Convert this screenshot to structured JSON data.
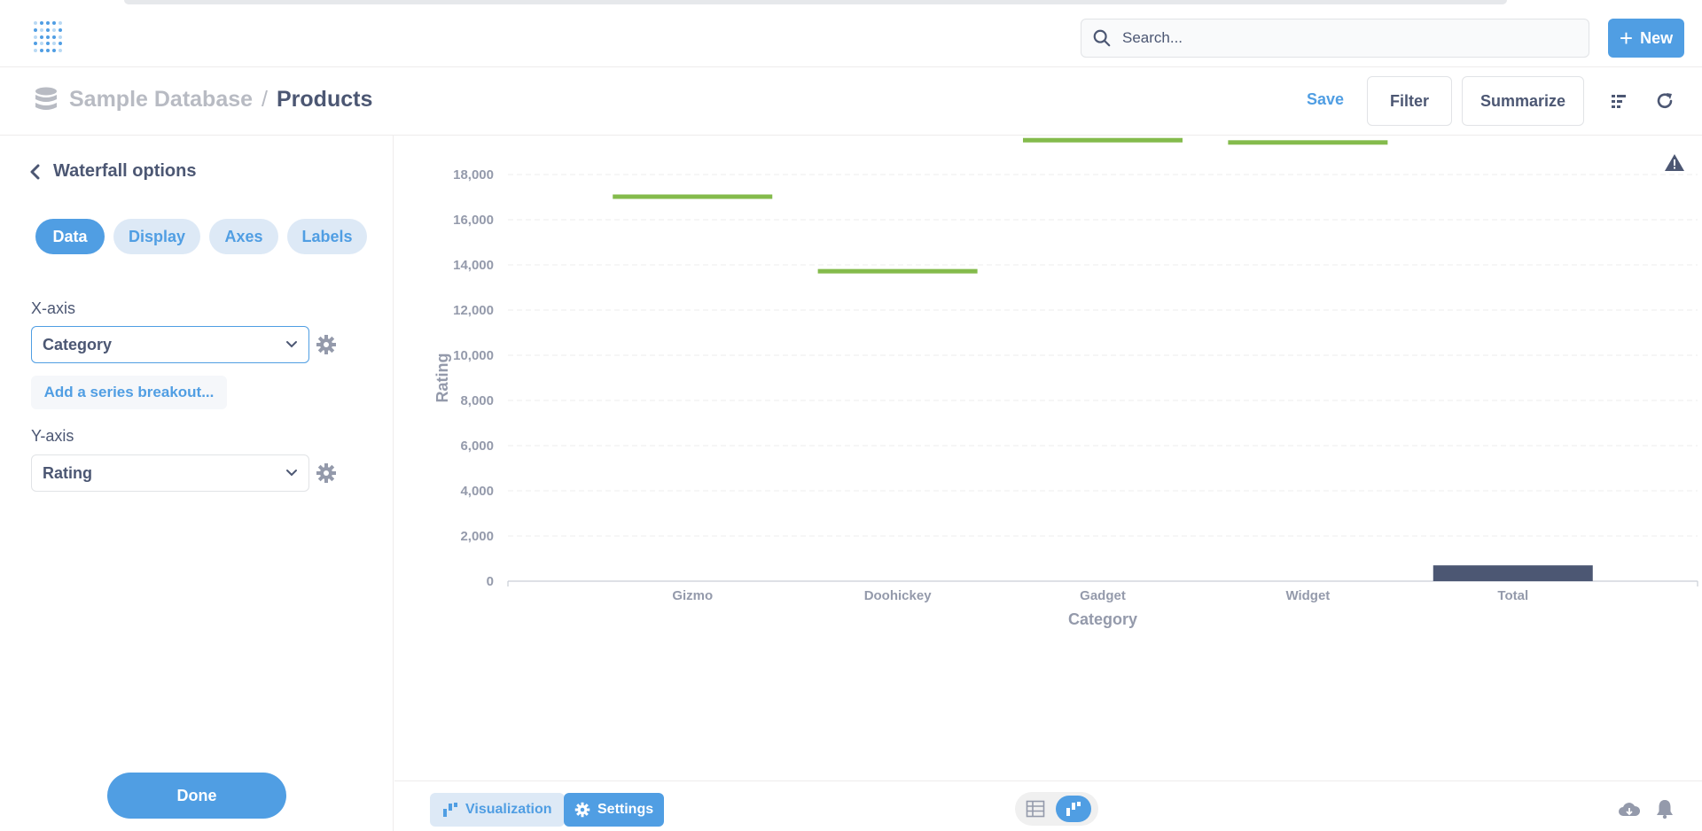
{
  "topnav": {
    "search_placeholder": "Search...",
    "new_label": "New"
  },
  "header": {
    "database": "Sample Database",
    "separator": "/",
    "table": "Products",
    "save_label": "Save",
    "filter_label": "Filter",
    "summarize_label": "Summarize"
  },
  "sidebar": {
    "title": "Waterfall options",
    "tabs": [
      {
        "label": "Data",
        "active": true
      },
      {
        "label": "Display",
        "active": false
      },
      {
        "label": "Axes",
        "active": false
      },
      {
        "label": "Labels",
        "active": false
      }
    ],
    "x_axis_label": "X-axis",
    "x_axis_value": "Category",
    "breakout_label": "Add a series breakout...",
    "y_axis_label": "Y-axis",
    "y_axis_value": "Rating",
    "done_label": "Done"
  },
  "footer": {
    "visualization_label": "Visualization",
    "settings_label": "Settings"
  },
  "colors": {
    "accent": "#509ee3",
    "increase": "#84bb4c",
    "total": "#4c5773",
    "axis_text": "#949aab"
  },
  "chart_data": {
    "type": "waterfall",
    "categories": [
      "Gizmo",
      "Doohickey",
      "Gadget",
      "Widget",
      "Total"
    ],
    "values": [
      17000,
      13700,
      19500,
      19400,
      700
    ],
    "bar_kind": [
      "increase",
      "increase",
      "increase",
      "increase",
      "total"
    ],
    "xlabel": "Category",
    "ylabel": "Rating",
    "yticks": [
      0,
      2000,
      4000,
      6000,
      8000,
      10000,
      12000,
      14000,
      16000,
      18000
    ],
    "ytick_labels": [
      "0",
      "2,000",
      "4,000",
      "6,000",
      "8,000",
      "10,000",
      "12,000",
      "14,000",
      "16,000",
      "18,000"
    ],
    "ylim": [
      0,
      18000
    ],
    "grid": true
  }
}
